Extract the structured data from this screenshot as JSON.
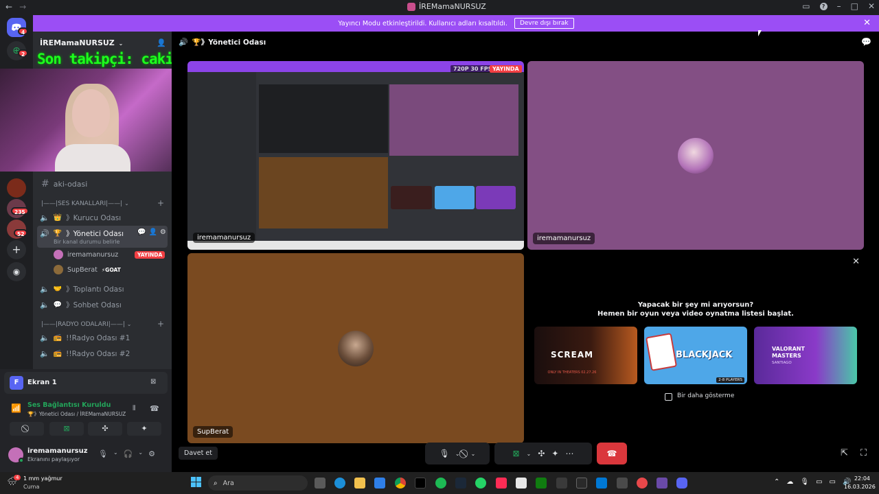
{
  "window": {
    "title": "İREMamaNURSUZ"
  },
  "banner": {
    "text": "Yayıncı Modu etkinleştirildi. Kullanıcı adları kısaltıldı.",
    "button": "Devre dışı bırak"
  },
  "rail": {
    "badges": [
      "4",
      "2",
      "235",
      "52"
    ]
  },
  "server": {
    "name": "İREMamaNURSUZ"
  },
  "overlay": {
    "text": "Son takipçi: cakir"
  },
  "channels": {
    "text_channel": "aki-odasi",
    "voice_category": "|——|SES KANALLARI|——|",
    "voice": [
      {
        "emoji": "👑",
        "name": "》Kurucu Odası"
      },
      {
        "emoji": "🏆",
        "name": "》Yönetici Odası",
        "status": "Bir kanal durumu belirle"
      },
      {
        "emoji": "🤝",
        "name": "》Toplantı Odası"
      },
      {
        "emoji": "💬",
        "name": "》Sohbet Odası"
      }
    ],
    "members": [
      {
        "name": "iremamanursuz",
        "badge": "YAYINDA"
      },
      {
        "name": "SupBerat",
        "badge": "⚡GOAT"
      }
    ],
    "radio_category": "|——|RADYO ODALARI|——|",
    "radio": [
      "!!Radyo Odası #1",
      "!!Radyo Odası #2"
    ]
  },
  "user_panel": {
    "screen_label": "Ekran 1",
    "screen_initial": "F",
    "voice_connected": "Ses Bağlantısı Kuruldu",
    "voice_location": "🏆》Yönetici Odası / İREMamaNURSUZ",
    "username": "iremamanursuz",
    "user_status": "Ekranını paylaşıyor"
  },
  "call": {
    "channel": "🏆》Yönetici Odası",
    "stream_quality": "720P 30 FPS",
    "live_badge": "YAYINDA",
    "tiles": [
      {
        "name": "iremamanursuz"
      },
      {
        "name": "iremamanursuz"
      },
      {
        "name": "SupBerat"
      }
    ],
    "invite": "Davet et"
  },
  "activities": {
    "line1": "Yapacak bir şey mi arıyorsun?",
    "line2": "Hemen bir oyun veya video oynatma listesi başlat.",
    "games": [
      {
        "name": "SCREAM",
        "sub": "ONLY IN THEATERS 02.27.26"
      },
      {
        "name": "BLACKJACK",
        "sub": "2-8 PLAYERS"
      },
      {
        "name": "VALORANT MASTERS",
        "sub": "SANTIAGO"
      }
    ],
    "dont_show": "Bir daha gösterme"
  },
  "taskbar": {
    "weather_temp": "1 mm yağmur",
    "weather_day": "Cuma",
    "search": "Ara",
    "time": "22:04",
    "date": "16.03.2026",
    "weather_badge": "4"
  },
  "colors": {
    "accent": "#9b4ef5",
    "live": "#f23f43",
    "green": "#23a55a",
    "blurple": "#5865f2"
  }
}
